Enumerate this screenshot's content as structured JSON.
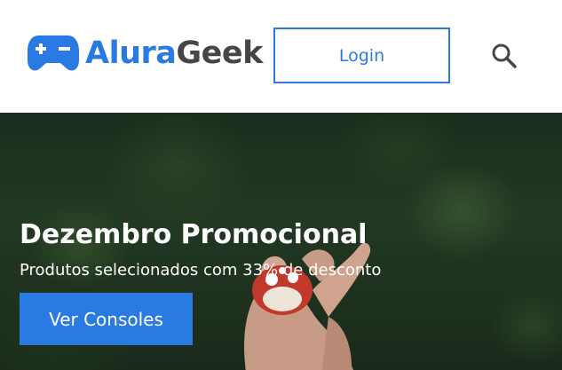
{
  "header": {
    "logo": {
      "part1": "Alura",
      "part2": "Geek",
      "icon": "gamepad-icon"
    },
    "login_label": "Login",
    "search_icon": "search-icon"
  },
  "banner": {
    "title": "Dezembro Promocional",
    "subtitle": "Produtos selecionados com 33% de desconto",
    "cta_label": "Ver Consoles"
  },
  "colors": {
    "accent": "#2a7ae4",
    "logo_dark": "#464646",
    "banner_text": "#ffffff"
  }
}
